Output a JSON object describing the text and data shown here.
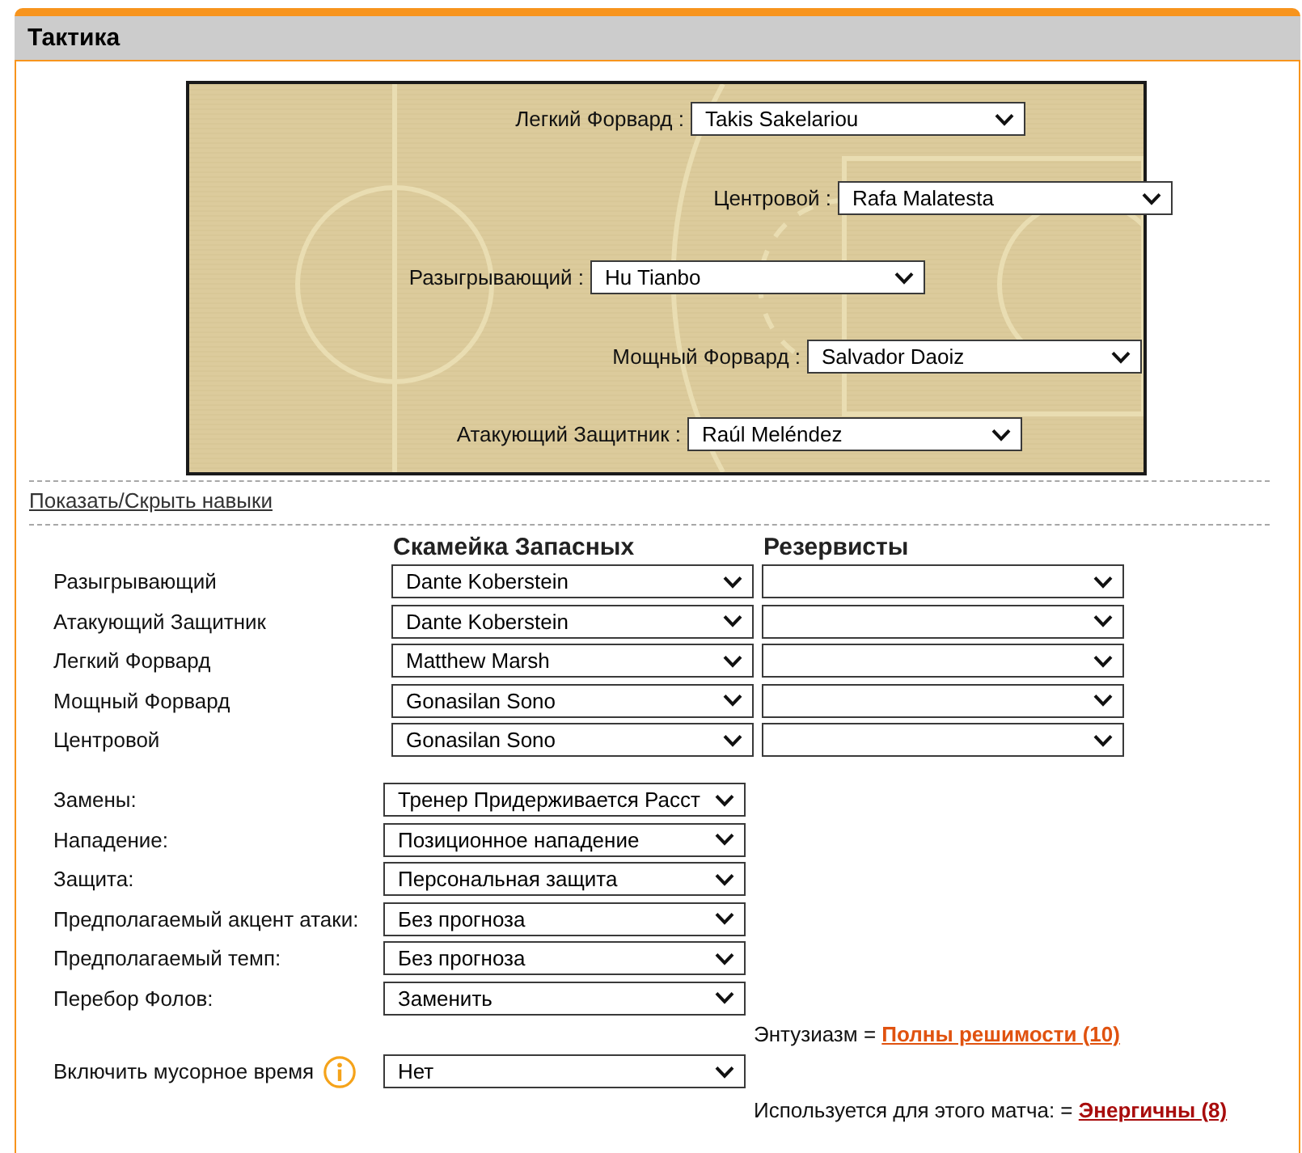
{
  "panel": {
    "title": "Тактика"
  },
  "court": {
    "positions": [
      {
        "label": "Легкий Форвард :",
        "player": "Takis Sakelariou"
      },
      {
        "label": "Центровой :",
        "player": "Rafa Malatesta"
      },
      {
        "label": "Разыгрывающий :",
        "player": "Hu Tianbo"
      },
      {
        "label": "Мощный Форвард :",
        "player": "Salvador Daoiz"
      },
      {
        "label": "Атакующий Защитник :",
        "player": "Raúl Meléndez"
      }
    ]
  },
  "skills_toggle": {
    "label": "Показать/Скрыть навыки"
  },
  "substitutes": {
    "columns": [
      "Скамейка Запасных",
      "Резервисты"
    ],
    "rows": [
      {
        "position": "Разыгрывающий",
        "bench": "Dante Koberstein"
      },
      {
        "position": "Атакующий Защитник",
        "bench": "Dante Koberstein"
      },
      {
        "position": "Легкий Форвард",
        "bench": "Matthew Marsh"
      },
      {
        "position": "Мощный Форвард",
        "bench": "Gonasilan Sono"
      },
      {
        "position": "Центровой",
        "bench": "Gonasilan Sono"
      }
    ]
  },
  "settings": [
    {
      "label": "Замены:",
      "value": "Тренер Придерживается Расст"
    },
    {
      "label": "Нападение:",
      "value": "Позиционное нападение"
    },
    {
      "label": "Защита:",
      "value": "Персональная защита"
    },
    {
      "label": "Предполагаемый акцент атаки:",
      "value": "Без прогноза"
    },
    {
      "label": "Предполагаемый темп:",
      "value": "Без прогноза"
    },
    {
      "label": "Перебор Фолов:",
      "value": "Заменить"
    }
  ],
  "enthusiasm": {
    "label": "Энтузиазм =",
    "value": "Полны решимости (10)"
  },
  "garbage_time": {
    "label": "Включить мусорное время",
    "value": "Нет"
  },
  "match_energy": {
    "label": "Используется для этого матча: =",
    "value": "Энергичны (8)"
  }
}
